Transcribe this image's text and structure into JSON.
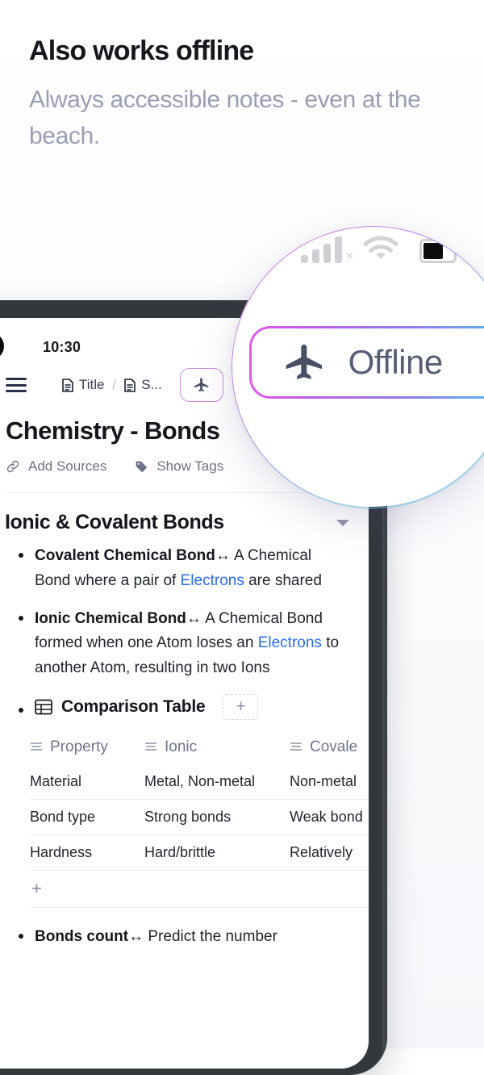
{
  "promo": {
    "title": "Also works offline",
    "subtitle": "Always accessible notes - even at the beach."
  },
  "phone": {
    "status": {
      "time": "10:30"
    },
    "toolbar": {
      "menu_icon": "hamburger-menu-icon",
      "breadcrumb": [
        {
          "icon": "document-icon",
          "label": "Title"
        },
        {
          "icon": "document-icon",
          "label": "S..."
        }
      ],
      "separator": "/",
      "offline_pill_icon": "airplane-icon"
    },
    "note": {
      "title": "Chemistry -  Bonds",
      "meta": [
        {
          "icon": "link-icon",
          "label": "Add Sources"
        },
        {
          "icon": "tag-icon",
          "label": "Show Tags"
        }
      ],
      "heading": "Ionic & Covalent Bonds",
      "collapse_icon": "chevron-down-icon",
      "bullets": [
        {
          "term": "Covalent Chemical Bond",
          "arrow": "↔",
          "text_before_link": " A Chemical Bond where a pair of ",
          "link": "Electrons",
          "text_after_link": " are shared"
        },
        {
          "term": "Ionic Chemical Bond",
          "arrow": "↔",
          "text_before_link": " A Chemical Bond formed when one Atom loses an ",
          "link": "Electrons",
          "text_after_link": " to another Atom, resulting in two Ions"
        }
      ],
      "table_block": {
        "icon": "table-icon",
        "title": "Comparison Table",
        "add_column_label": "+",
        "add_row_label": "+",
        "column_icon": "text-column-icon",
        "headers": [
          "Property",
          "Ionic",
          "Covale"
        ],
        "rows": [
          [
            "Material",
            "Metal, Non-metal",
            "Non-metal"
          ],
          [
            "Bond type",
            "Strong bonds",
            "Weak bond"
          ],
          [
            "Hardness",
            "Hard/brittle",
            "Relatively"
          ]
        ]
      },
      "last_bullet": {
        "term": "Bonds count",
        "arrow": "↔",
        "text": " Predict the number"
      }
    }
  },
  "magnifier": {
    "status_icons": {
      "signal": "signal-bars-icon",
      "signal_badge": "×",
      "wifi": "wifi-icon",
      "battery": "battery-icon"
    },
    "offline_pill": {
      "icon": "airplane-icon",
      "label": "Offline"
    }
  },
  "colors": {
    "accent_start": "#e15ae8",
    "accent_end": "#34c9e6",
    "link": "#2b6cf0",
    "muted_text": "#9a9db4",
    "heading": "#16161d",
    "bezel": "#33383d"
  }
}
